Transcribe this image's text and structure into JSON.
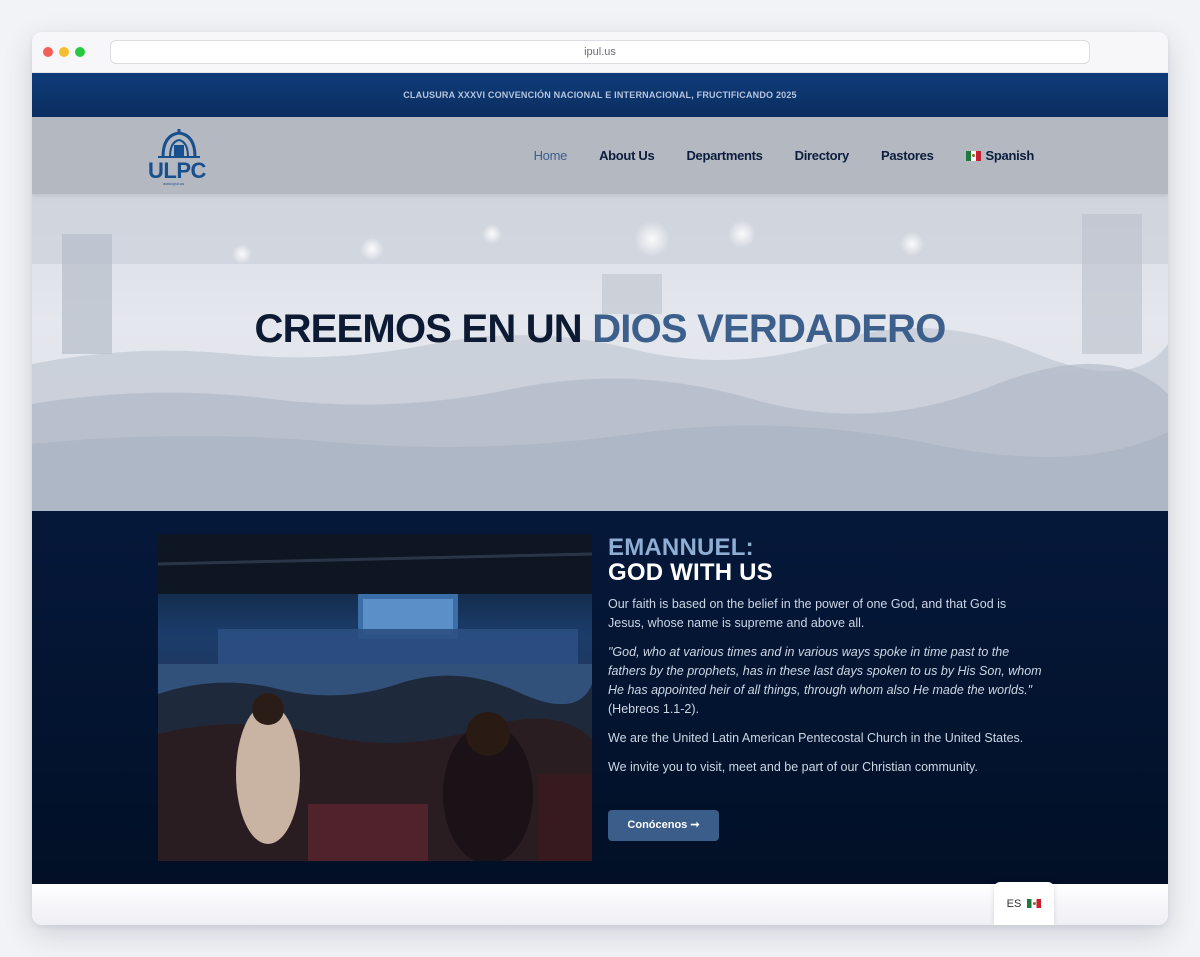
{
  "browser": {
    "url": "ipul.us"
  },
  "announcement": {
    "text": "CLAUSURA XXXVI CONVENCIÓN NACIONAL E INTERNACIONAL, FRUCTIFICANDO 2025"
  },
  "logo": {
    "text": "ULPC",
    "subtext": "www.ipul.us"
  },
  "nav": {
    "items": [
      {
        "label": "Home",
        "active": true
      },
      {
        "label": "About Us"
      },
      {
        "label": "Departments"
      },
      {
        "label": "Directory"
      },
      {
        "label": "Pastores"
      },
      {
        "label": "Spanish",
        "icon": "mexico-flag-icon"
      }
    ]
  },
  "hero": {
    "title_part1": "CREEMOS EN UN ",
    "title_accent": "DIOS VERDADERO"
  },
  "about": {
    "heading_line1": "EMANNUEL:",
    "heading_line2": "GOD WITH US",
    "paragraph1": "Our faith is based on the belief in the power of one God, and that God is Jesus, whose name is supreme and above all.",
    "quote": "\"God, who at various times and in various ways spoke in time past to the fathers by the prophets, has in these last days spoken to us by His Son, whom He has appointed heir of all things, through whom also He made the worlds.\"",
    "quote_ref": " (Hebreos 1.1-2).",
    "paragraph2": "We are the United Latin American Pentecostal Church in the United States.",
    "paragraph3": "We invite you to visit, meet and be part of our Christian community.",
    "button_label": "Conócenos ➞"
  },
  "language_widget": {
    "code": "ES",
    "icon": "mexico-flag-icon"
  },
  "colors": {
    "navy": "#031430",
    "accent": "#3d5f8c",
    "nav_bg": "#b3b8c1",
    "light_accent": "#8eaed4"
  }
}
